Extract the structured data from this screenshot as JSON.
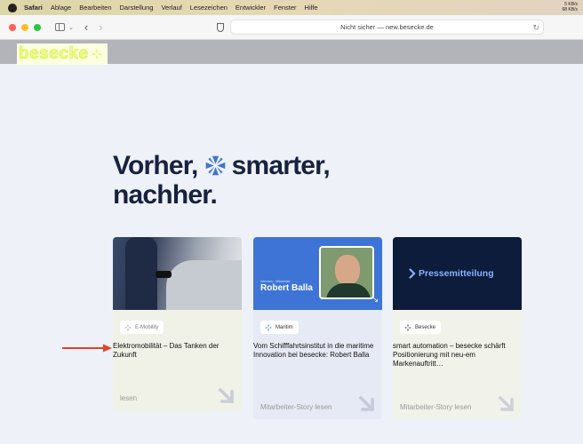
{
  "menubar": {
    "app": "Safari",
    "items": [
      "Ablage",
      "Bearbeiten",
      "Darstellung",
      "Verlauf",
      "Lesezeichen",
      "Entwickler",
      "Fenster",
      "Hilfe"
    ],
    "net_up": "5 KB/s",
    "net_down": "68 KB/s"
  },
  "browser": {
    "url_text": "Nicht sicher — new.besecke.de"
  },
  "site": {
    "logo_text": "besecke"
  },
  "hero": {
    "line1_a": "Vorher,",
    "line1_b": "smarter,",
    "line2": "nachher."
  },
  "cards": [
    {
      "tag": "E-Mobility",
      "title": "Elektromobilität – Das Tanken der Zukunft",
      "link": "lesen"
    },
    {
      "image_small_label": "Interview · Mitarbeiter",
      "image_name": "Robert Balla",
      "tag": "Maritim",
      "title": "Vom Schifffahrtsinstitut in die maritime Innovation bei besecke: Robert Balla",
      "link": "Mitarbeiter-Story lesen"
    },
    {
      "image_text": "Pressemitteilung",
      "tag": "Besecke",
      "title": "smart automation – besecke schärft Positionierung mit neu-em Markenauftritt…",
      "link": "Mitarbeiter-Story lesen"
    }
  ],
  "colors": {
    "hero_text": "#17223f",
    "brand_blue": "#3e74d6",
    "annotation": "#e0442b"
  }
}
